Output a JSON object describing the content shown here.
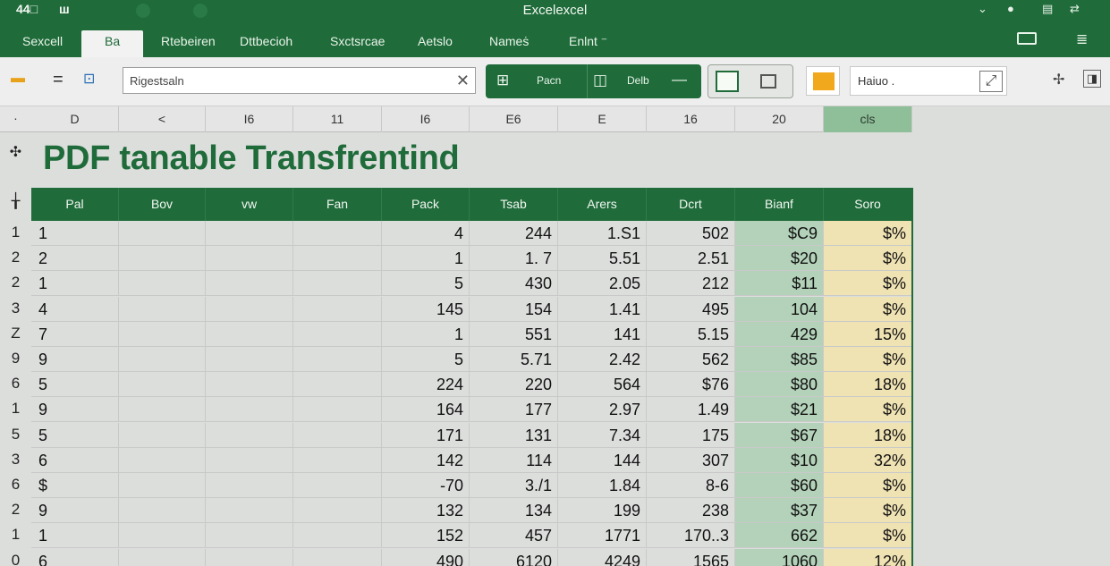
{
  "titlebar": {
    "left_icons": [
      "44□",
      "ш"
    ],
    "title": "Excelexcel",
    "right_icons": [
      "chevron-down-icon",
      "circle-icon",
      "share-icon",
      "sync-icon"
    ]
  },
  "ribbon": {
    "tabs": [
      {
        "label": "Sexcell",
        "active": false
      },
      {
        "label": "Ba",
        "active": true
      },
      {
        "label": "Rtebeiren",
        "active": false
      },
      {
        "label": "Dttbecioh",
        "active": false
      },
      {
        "label": "Sxctsrcae",
        "active": false
      },
      {
        "label": "Aetslo",
        "active": false
      },
      {
        "label": "Nameṡ",
        "active": false
      },
      {
        "label": "Enlnt ⁻",
        "active": false
      }
    ]
  },
  "toolbar": {
    "search_value": "Rigestsaln",
    "green_group": {
      "button1": "Pacn",
      "button2": "Delb"
    },
    "font_box_value": "Haiuo ."
  },
  "columns": {
    "corner": "·",
    "letters": [
      "D",
      "<",
      "I6",
      "11",
      "I6",
      "E6",
      "Ε",
      "16",
      "20",
      "cls"
    ]
  },
  "sheet": {
    "title": "PDF tanable Transfrentind",
    "title_row_marker": "✣",
    "header_row_marker": "╁",
    "headers": [
      "Pal",
      "Bov",
      "vw",
      "Fan",
      "Pack",
      "Tsab",
      "Arers",
      "Dcrt",
      "Bianf",
      "Soro"
    ],
    "rows": [
      {
        "rh": "1",
        "cells": [
          "1",
          "",
          "",
          "",
          "4",
          "244",
          "1.S1",
          "502",
          "$C9",
          "$%"
        ]
      },
      {
        "rh": "2",
        "cells": [
          "2",
          "",
          "",
          "",
          "1",
          "1. 7",
          "5.51",
          "2.51",
          "$20",
          "$%"
        ]
      },
      {
        "rh": "2",
        "cells": [
          "1",
          "",
          "",
          "",
          "5",
          "430",
          "2.05",
          "212",
          "$11",
          "$%"
        ]
      },
      {
        "rh": "3",
        "cells": [
          "4",
          "",
          "",
          "",
          "145",
          "154",
          "1.41",
          "495",
          "104",
          "$%"
        ]
      },
      {
        "rh": "Z",
        "cells": [
          "7",
          "",
          "",
          "",
          "1",
          "551",
          "141",
          "5.15",
          "429",
          "15%"
        ]
      },
      {
        "rh": "9",
        "cells": [
          "9",
          "",
          "",
          "",
          "5",
          "5.71",
          "2.42",
          "562",
          "$85",
          "$%"
        ]
      },
      {
        "rh": "6",
        "cells": [
          "5",
          "",
          "",
          "",
          "224",
          "220",
          "564",
          "$76",
          "$80",
          "18%"
        ]
      },
      {
        "rh": "1",
        "cells": [
          "9",
          "",
          "",
          "",
          "164",
          "177",
          "2.97",
          "1.49",
          "$21",
          "$%"
        ]
      },
      {
        "rh": "5",
        "cells": [
          "5",
          "",
          "",
          "",
          "171",
          "131",
          "7.34",
          "175",
          "$67",
          "18%"
        ]
      },
      {
        "rh": "3",
        "cells": [
          "6",
          "",
          "",
          "",
          "142",
          "114",
          "144",
          "307",
          "$10",
          "32%"
        ]
      },
      {
        "rh": "6",
        "cells": [
          "$",
          "",
          "",
          "",
          "-70",
          "3./1",
          "1.84",
          "8-6",
          "$60",
          "$%"
        ]
      },
      {
        "rh": "2",
        "cells": [
          "9",
          "",
          "",
          "",
          "132",
          "134",
          "199",
          "238",
          "$37",
          "$%"
        ]
      },
      {
        "rh": "1",
        "cells": [
          "1",
          "",
          "",
          "",
          "152",
          "457",
          "1771",
          "170..3",
          "662",
          "$%"
        ]
      },
      {
        "rh": "0",
        "cells": [
          "6",
          "",
          "",
          "",
          "490",
          "6120",
          "4249",
          "1565",
          "1060",
          "12%"
        ]
      }
    ]
  },
  "colors": {
    "brand_green": "#1f6b3a",
    "selected_column": "#8fbf99",
    "green_column_fill": "#b3d2b9",
    "yellow_column_fill": "#efe2b3",
    "accent_orange": "#f2a81d"
  }
}
